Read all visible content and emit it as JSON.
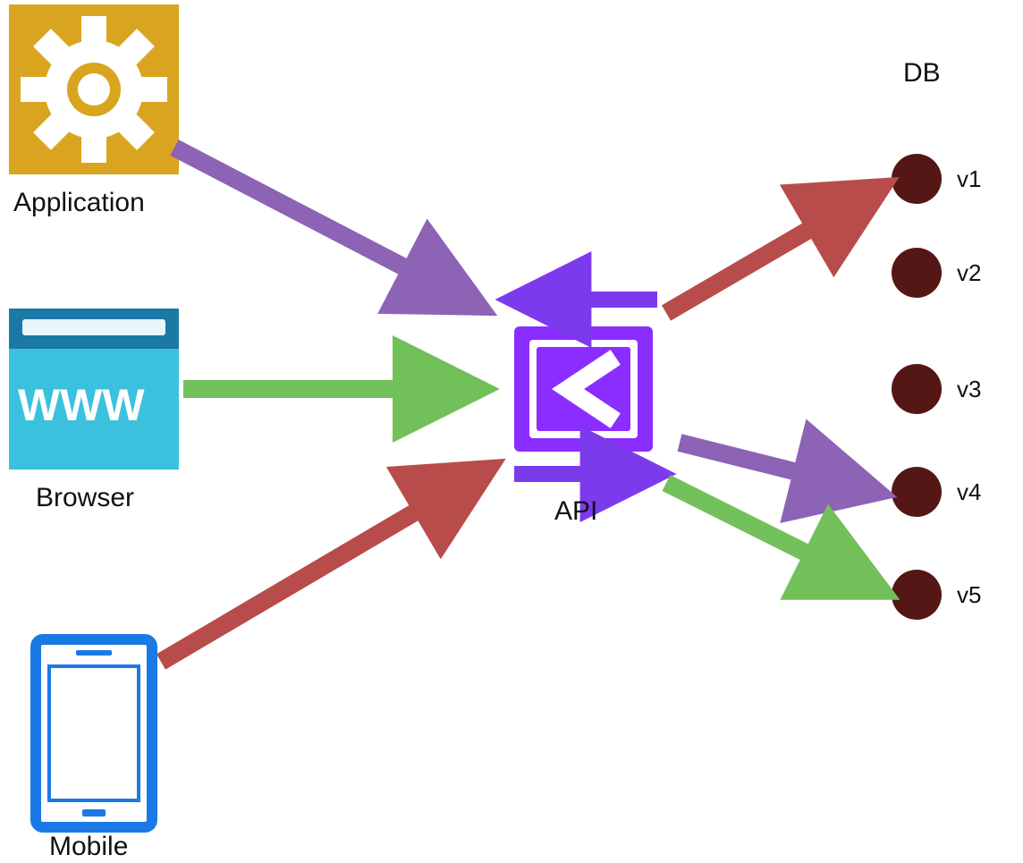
{
  "diagram": {
    "clients": {
      "application": {
        "label": "Application"
      },
      "browser": {
        "label": "Browser",
        "www_text": "WWW"
      },
      "mobile": {
        "label": "Mobile"
      }
    },
    "api": {
      "label": "API"
    },
    "db": {
      "title": "DB",
      "nodes": [
        {
          "label": "v1"
        },
        {
          "label": "v2"
        },
        {
          "label": "v3"
        },
        {
          "label": "v4"
        },
        {
          "label": "v5"
        }
      ]
    },
    "colors": {
      "purple_arrow": "#8d63b5",
      "green_arrow": "#72c05a",
      "red_arrow": "#b84c4a",
      "violet_arrow": "#7c3aed",
      "api_fill": "#8b2dff",
      "api_inner": "#ffffff",
      "gear_bg": "#d9a520",
      "gear_fg": "#ffffff",
      "browser_top": "#1b79a6",
      "browser_body": "#3bc1de",
      "browser_text": "#ffffff",
      "mobile_stroke": "#1b79e6",
      "mobile_fill": "#ffffff",
      "db_node": "#541715"
    }
  }
}
